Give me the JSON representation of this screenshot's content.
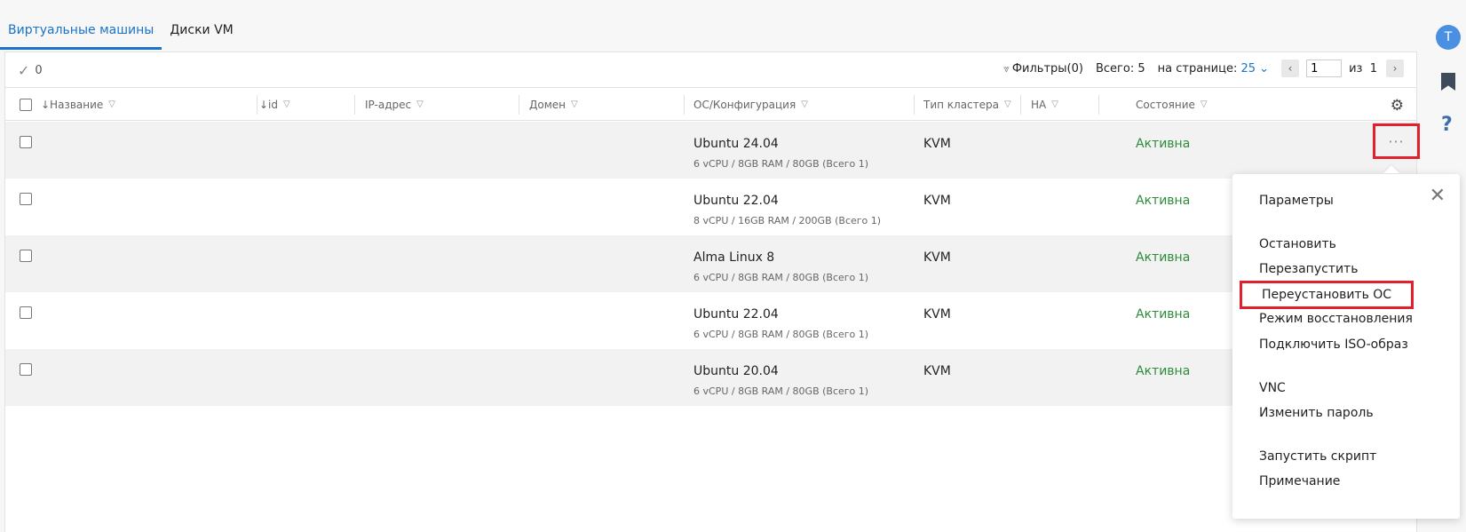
{
  "tabs": [
    {
      "label": "Виртуальные машины",
      "active": true
    },
    {
      "label": "Диски VM",
      "active": false
    }
  ],
  "toolbar": {
    "selected_count": "0",
    "filters_label": "Фильтры(0)",
    "total_label": "Всего: 5",
    "per_page_label": "на странице:",
    "per_page_value": "25",
    "page_current": "1",
    "page_of_label": "из",
    "page_total": "1"
  },
  "table": {
    "columns": [
      "↓Название",
      "↓id",
      "IP-адрес",
      "Домен",
      "ОС/Конфигурация",
      "Тип кластера",
      "HA",
      "Состояние"
    ],
    "rows": [
      {
        "os": "Ubuntu 24.04",
        "config": "6 vCPU / 8GB RAM / 80GB (Всего 1)",
        "cluster": "KVM",
        "state": "Активна"
      },
      {
        "os": "Ubuntu 22.04",
        "config": "8 vCPU / 16GB RAM / 200GB (Всего 1)",
        "cluster": "KVM",
        "state": "Активна"
      },
      {
        "os": "Alma Linux 8",
        "config": "6 vCPU / 8GB RAM / 80GB (Всего 1)",
        "cluster": "KVM",
        "state": "Активна"
      },
      {
        "os": "Ubuntu 22.04",
        "config": "6 vCPU / 8GB RAM / 80GB (Всего 1)",
        "cluster": "KVM",
        "state": "Активна"
      },
      {
        "os": "Ubuntu 20.04",
        "config": "6 vCPU / 8GB RAM / 80GB (Всего 1)",
        "cluster": "KVM",
        "state": "Активна"
      }
    ]
  },
  "row_menu": {
    "items": [
      {
        "label": "Параметры",
        "highlighted": false
      },
      {
        "label": "Остановить",
        "highlighted": false
      },
      {
        "label": "Перезапустить",
        "highlighted": false
      },
      {
        "label": "Переустановить ОС",
        "highlighted": true
      },
      {
        "label": "Режим восстановления",
        "highlighted": false
      },
      {
        "label": "Подключить ISO-образ",
        "highlighted": false
      },
      {
        "label": "VNC",
        "highlighted": false
      },
      {
        "label": "Изменить пароль",
        "highlighted": false
      },
      {
        "label": "Запустить скрипт",
        "highlighted": false
      },
      {
        "label": "Примечание",
        "highlighted": false
      }
    ]
  },
  "user": {
    "avatar_letter": "T"
  },
  "colors": {
    "accent": "#1a73c8",
    "active_state": "#2e8b3a",
    "highlight_box": "#e0202a"
  }
}
